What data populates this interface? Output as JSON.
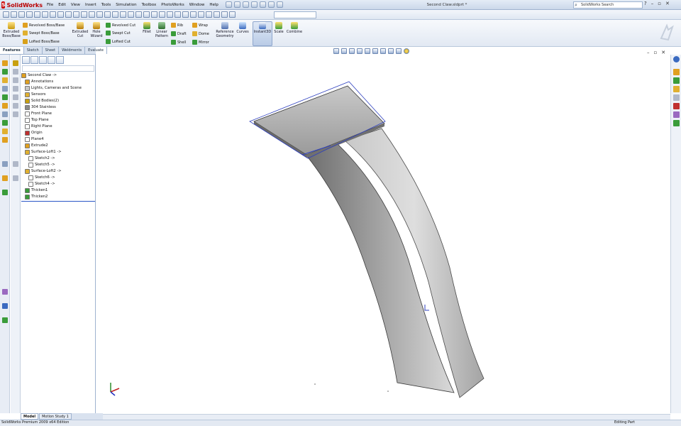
{
  "app": {
    "logo_text": "SolidWorks",
    "logo_mark": "S",
    "doc_title": "Second Claw.sldprt *"
  },
  "menu": [
    "File",
    "Edit",
    "View",
    "Insert",
    "Tools",
    "Simulation",
    "Toolbox",
    "PhotoWorks",
    "Window",
    "Help"
  ],
  "search": {
    "placeholder": "SolidWorks Search"
  },
  "window_controls": {
    "help": "?",
    "minimize": "–",
    "restore": "▫",
    "close": "✕"
  },
  "command_manager": {
    "extruded_boss": "Extruded Boss/Base",
    "revolved_boss": "Revolved Boss/Base",
    "swept_boss": "Swept Boss/Base",
    "lofted_boss": "Lofted Boss/Base",
    "extruded_cut": "Extruded Cut",
    "hole_wizard": "Hole Wizard",
    "revolved_cut": "Revolved Cut",
    "swept_cut": "Swept Cut",
    "lofted_cut": "Lofted Cut",
    "fillet": "Fillet",
    "linear_pattern": "Linear Pattern",
    "rib": "Rib",
    "draft": "Draft",
    "shell": "Shell",
    "wrap": "Wrap",
    "dome": "Dome",
    "mirror": "Mirror",
    "reference_geometry": "Reference Geometry",
    "curves": "Curves",
    "instant3d": "Instant3D",
    "scale": "Scale",
    "combine": "Combine"
  },
  "cmd_tabs": [
    "Features",
    "Sketch",
    "Sheet Metal",
    "Weldments",
    "Evaluate"
  ],
  "feature_tree": [
    {
      "label": "Second Claw ->",
      "icon": "part-icon",
      "indent": 0
    },
    {
      "label": "Annotations",
      "icon": "annotations-icon",
      "indent": 1
    },
    {
      "label": "Lights, Cameras and Scene",
      "icon": "lights-icon",
      "indent": 1
    },
    {
      "label": "Sensors",
      "icon": "sensors-icon",
      "indent": 1
    },
    {
      "label": "Solid Bodies(2)",
      "icon": "solid-bodies-icon",
      "indent": 1
    },
    {
      "label": "304 Stainless",
      "icon": "material-icon",
      "indent": 1
    },
    {
      "label": "Front Plane",
      "icon": "plane-icon",
      "indent": 1
    },
    {
      "label": "Top Plane",
      "icon": "plane-icon",
      "indent": 1
    },
    {
      "label": "Right Plane",
      "icon": "plane-icon",
      "indent": 1
    },
    {
      "label": "Origin",
      "icon": "origin-icon",
      "indent": 1
    },
    {
      "label": "Plane4",
      "icon": "plane-icon",
      "indent": 1
    },
    {
      "label": "Extrude2",
      "icon": "extrude-icon",
      "indent": 1
    },
    {
      "label": "Surface-Loft1 ->",
      "icon": "loft-icon",
      "indent": 1
    },
    {
      "label": "Sketch2 ->",
      "icon": "sketch-icon",
      "indent": 2
    },
    {
      "label": "Sketch5 ->",
      "icon": "sketch-icon",
      "indent": 2
    },
    {
      "label": "Surface-Loft2 ->",
      "icon": "loft-icon",
      "indent": 1
    },
    {
      "label": "Sketch6 ->",
      "icon": "sketch-icon",
      "indent": 2
    },
    {
      "label": "Sketch4 ->",
      "icon": "sketch-icon",
      "indent": 2
    },
    {
      "label": "Thicken1",
      "icon": "thicken-icon",
      "indent": 1
    },
    {
      "label": "Thicken2",
      "icon": "thicken-icon",
      "indent": 1
    }
  ],
  "bottom_tabs": [
    "Model",
    "Motion Study 1"
  ],
  "status": {
    "left": "SolidWorks Premium 2009 x64 Edition",
    "right": "Editing Part"
  },
  "colors": {
    "accent": "#2a56c6",
    "logo_red": "#c00000",
    "chrome_blue": "#cbd8ea"
  }
}
